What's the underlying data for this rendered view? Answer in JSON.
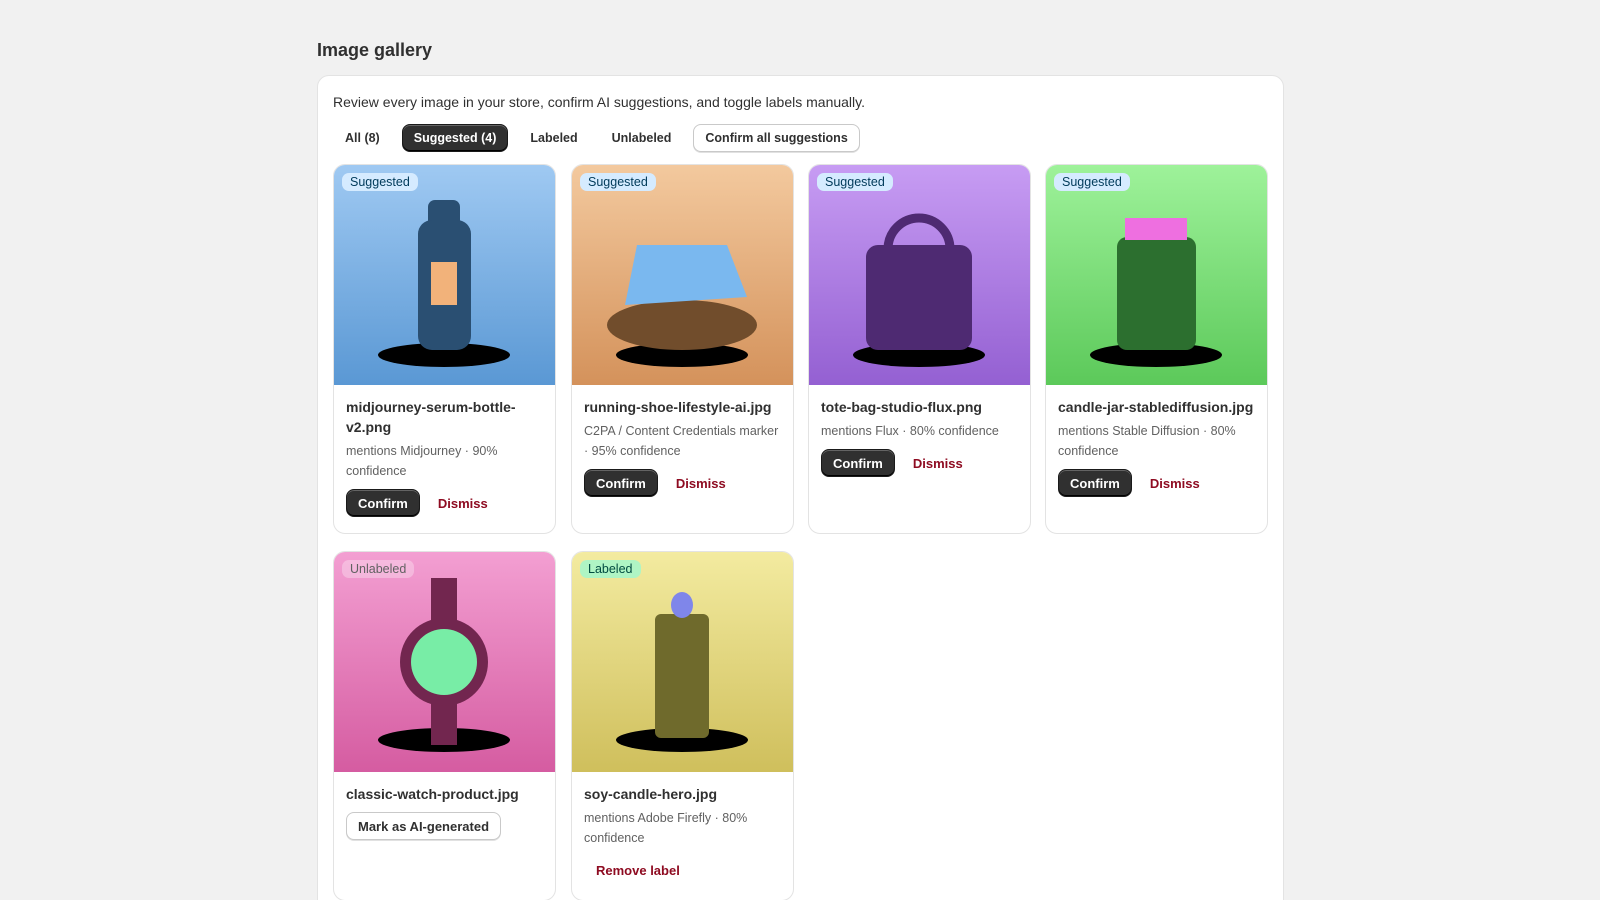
{
  "page": {
    "title": "Image gallery"
  },
  "panel": {
    "intro": "Review every image in your store, confirm AI suggestions, and toggle labels manually."
  },
  "tabs": {
    "all": "All (8)",
    "suggested": "Suggested (4)",
    "labeled": "Labeled",
    "unlabeled": "Unlabeled",
    "confirm_all": "Confirm all suggestions",
    "active": "suggested"
  },
  "colors": {
    "primary_button": "#303030",
    "critical_text": "#8e0b21",
    "suggested_badge": "#d5ebff",
    "labeled_badge": "#aff5c4"
  },
  "cards": [
    {
      "badge": "Suggested",
      "filename": "midjourney-serum-bottle-v2.png",
      "meta": "mentions Midjourney · 90% confidence",
      "confirm": "Confirm",
      "dismiss": "Dismiss",
      "image": "serum-bottle"
    },
    {
      "badge": "Suggested",
      "filename": "running-shoe-lifestyle-ai.jpg",
      "meta": "C2PA / Content Credentials marker · 95% confidence",
      "confirm": "Confirm",
      "dismiss": "Dismiss",
      "image": "running-shoe"
    },
    {
      "badge": "Suggested",
      "filename": "tote-bag-studio-flux.png",
      "meta": "mentions Flux · 80% confidence",
      "confirm": "Confirm",
      "dismiss": "Dismiss",
      "image": "tote-bag"
    },
    {
      "badge": "Suggested",
      "filename": "candle-jar-stablediffusion.jpg",
      "meta": "mentions Stable Diffusion · 80% confidence",
      "confirm": "Confirm",
      "dismiss": "Dismiss",
      "image": "candle-jar"
    },
    {
      "badge": "Unlabeled",
      "filename": "classic-watch-product.jpg",
      "mark": "Mark as AI-generated",
      "image": "watch"
    },
    {
      "badge": "Labeled",
      "filename": "soy-candle-hero.jpg",
      "meta": "mentions Adobe Firefly · 80% confidence",
      "remove": "Remove label",
      "image": "soy-candle"
    }
  ]
}
